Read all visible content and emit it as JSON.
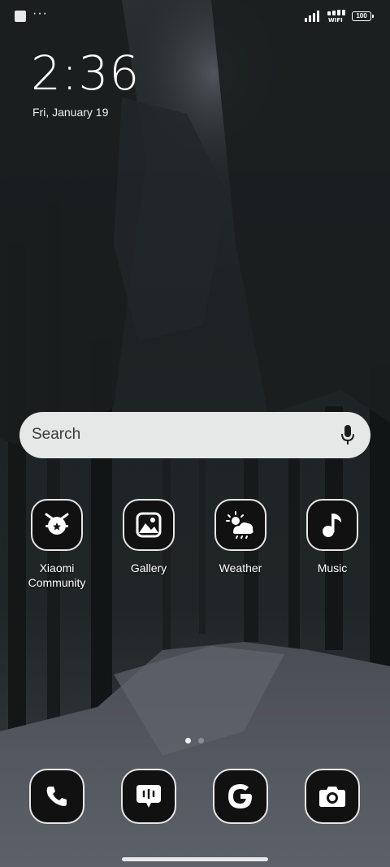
{
  "status_bar": {
    "wifi_label": "WIFI",
    "battery_level": "100",
    "more_glyph": "···",
    "icons": [
      "notification-square-icon",
      "signal-icon",
      "wifi-icon",
      "battery-icon"
    ]
  },
  "clock": {
    "time": "2:36",
    "date": "Fri, January 19"
  },
  "search": {
    "placeholder": "Search",
    "icon": "mic-icon"
  },
  "apps": [
    {
      "label": "Xiaomi\nCommunity",
      "icon": "xiaomi-community-icon"
    },
    {
      "label": "Gallery",
      "icon": "gallery-icon"
    },
    {
      "label": "Weather",
      "icon": "weather-icon"
    },
    {
      "label": "Music",
      "icon": "music-icon"
    }
  ],
  "page_indicator": {
    "pages": 2,
    "active": 0
  },
  "dock": [
    {
      "app": "Phone",
      "icon": "phone-icon"
    },
    {
      "app": "Messages",
      "icon": "messages-icon"
    },
    {
      "app": "Google",
      "icon": "google-icon"
    },
    {
      "app": "Camera",
      "icon": "camera-icon"
    }
  ],
  "colors": {
    "icon_bg": "#111111",
    "icon_border": "#e6e6e6",
    "search_bg": "#e6e7e7"
  }
}
